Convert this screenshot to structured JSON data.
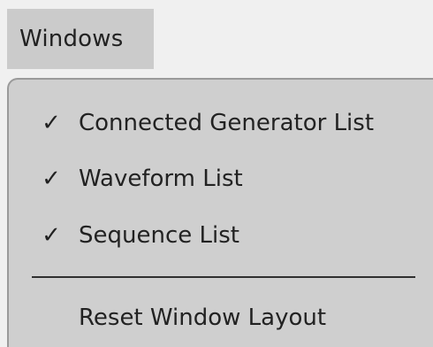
{
  "menubar": {
    "windows_label": "Windows"
  },
  "dropdown": {
    "items": [
      {
        "check": "✓",
        "label": "Connected Generator List",
        "checked": true
      },
      {
        "check": "✓",
        "label": "Waveform List",
        "checked": true
      },
      {
        "check": "✓",
        "label": "Sequence List",
        "checked": true
      }
    ],
    "reset_label": "Reset Window Layout"
  }
}
